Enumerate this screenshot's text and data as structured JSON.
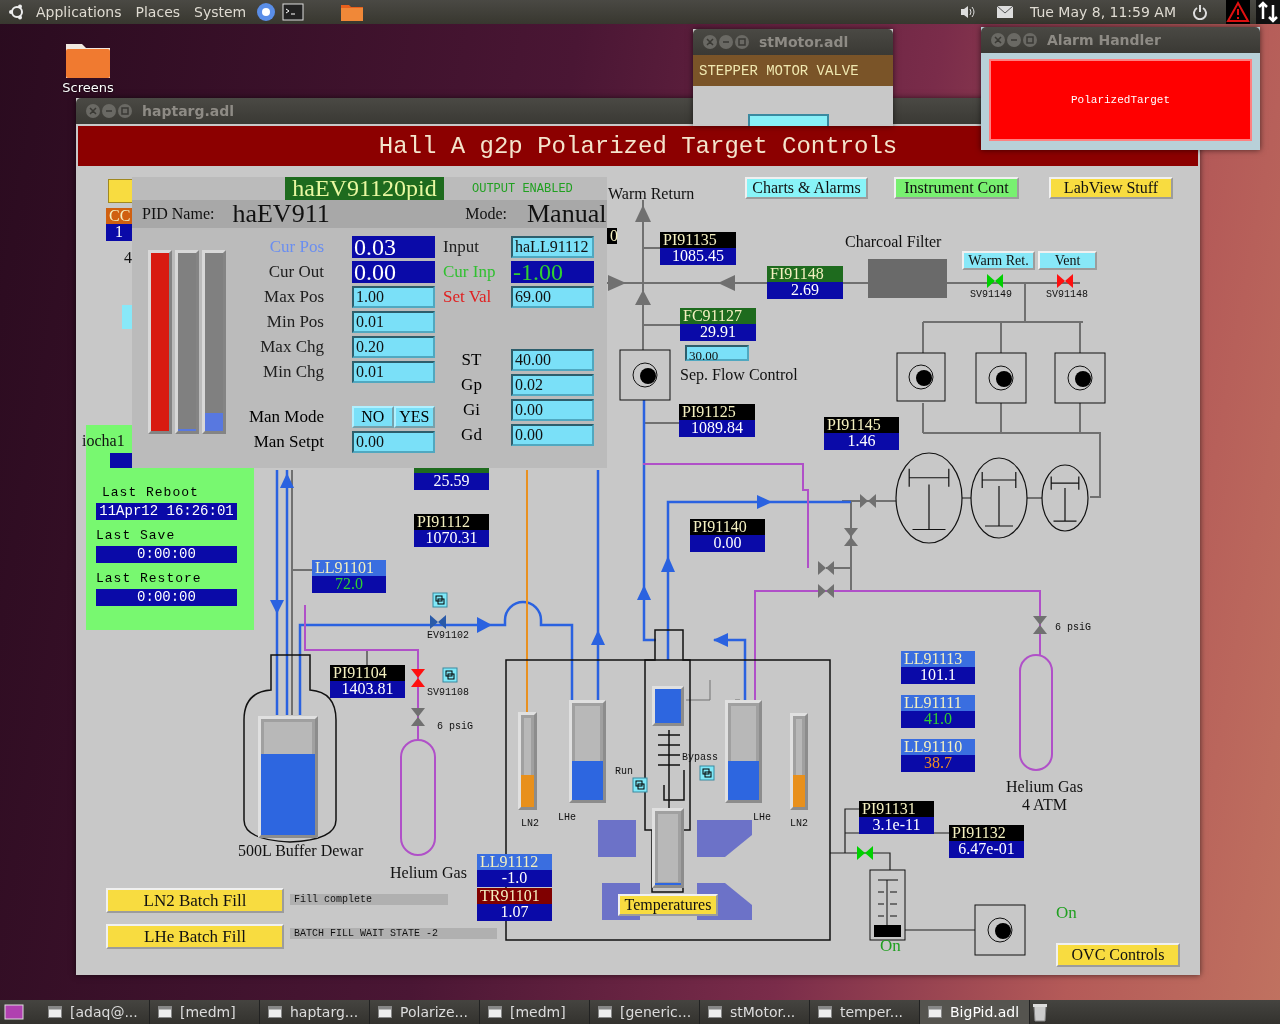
{
  "top_panel": {
    "menus": [
      "Applications",
      "Places",
      "System"
    ],
    "clock": "Tue May  8, 11:59 AM"
  },
  "desktop_icons": [
    {
      "label": "Screens"
    }
  ],
  "stmotor_window": {
    "title": "stMotor.adl",
    "heading": "STEPPER MOTOR VALVE"
  },
  "alarm_window": {
    "title": "Alarm Handler",
    "alarm": "PolarizedTarget"
  },
  "main_window": {
    "title": "haptarg.adl",
    "heading": "Hall A g2p Polarized Target Controls",
    "buttons": [
      {
        "label": "Charts & Alarms",
        "color": "#88f4f8"
      },
      {
        "label": "Instrument Cont",
        "color": "#78f070"
      },
      {
        "label": "LabView Stuff",
        "color": "#f8dc40"
      },
      {
        "label": "Warm Ret.",
        "color": "#88e8f8"
      },
      {
        "label": "Vent",
        "color": "#88e8f8"
      },
      {
        "label": "LN2 Batch Fill",
        "color": "#f8dc40"
      },
      {
        "label": "LHe Batch Fill",
        "color": "#f8dc40"
      },
      {
        "label": "Temperatures",
        "color": "#f8dc40"
      },
      {
        "label": "OVC Controls",
        "color": "#f8dc40"
      }
    ],
    "readouts": [
      {
        "tag": "CC",
        "value": "1",
        "color": "#d06010"
      },
      {
        "tag": "0",
        "color": "#000000"
      },
      {
        "tag": "PI91135",
        "value": "1085.45",
        "color": "#000000"
      },
      {
        "tag": "FI91148",
        "value": "2.69",
        "color": "#1e6b1e"
      },
      {
        "tag": "FC91127",
        "value": "29.91",
        "color": "#1e6b1e"
      },
      {
        "tag": "PI91125",
        "value": "1089.84",
        "color": "#000000"
      },
      {
        "tag": "PI91145",
        "value": "1.46",
        "color": "#000000"
      },
      {
        "value": "25.59",
        "color": "#1e6b1e"
      },
      {
        "tag": "PI91112",
        "value": "1070.31",
        "color": "#000000"
      },
      {
        "tag": "PI91140",
        "value": "0.00",
        "color": "#000000"
      },
      {
        "tag": "LL91101",
        "value": "72.0",
        "kind": "ok",
        "color": "#3a6ee0"
      },
      {
        "tag": "PI91104",
        "value": "1403.81",
        "color": "#000000"
      },
      {
        "tag": "LL91113",
        "value": "101.1",
        "color": "#3a6ee0"
      },
      {
        "tag": "LL91111",
        "value": "41.0",
        "kind": "ok",
        "color": "#3a6ee0"
      },
      {
        "tag": "LL91110",
        "value": "38.7",
        "kind": "warning",
        "color": "#3a6ee0"
      },
      {
        "tag": "PI91131",
        "value": "3.1e-11",
        "color": "#000000"
      },
      {
        "tag": "PI91132",
        "value": "6.47e-01",
        "color": "#000000"
      },
      {
        "tag": "LL91112",
        "value": "-1.0",
        "color": "#3a6ee0"
      },
      {
        "tag": "TR91101",
        "value": "1.07",
        "color": "#800000"
      }
    ],
    "setpoint_field": "30.00",
    "valves": [
      {
        "label": "SV91149",
        "color": "#00d000"
      },
      {
        "label": "SV91148",
        "color": "#ff1010"
      },
      {
        "label": "EV91102",
        "color": "#2a5aa8"
      },
      {
        "label": "SV91108",
        "color": "#ff1010"
      },
      {
        "color": "#00d000"
      }
    ],
    "gauges": [
      {
        "level": 0.7,
        "color": "#2d66e0"
      },
      {
        "label": "LN2",
        "level": 0.35,
        "color": "#e8901c"
      },
      {
        "label": "LHe",
        "level": 0.4,
        "color": "#2d66e0"
      },
      {
        "level": 1,
        "color": "#2d66e0"
      },
      {
        "level": 0,
        "color": "#2d66e0"
      },
      {
        "label": "LHe",
        "level": 0.4,
        "color": "#2d66e0"
      },
      {
        "label": "LN2",
        "level": 0.35,
        "color": "#e8901c"
      }
    ],
    "captions": [
      {
        "text": "Warm Return",
        "kind": "caption"
      },
      {
        "text": "Charcoal Filter",
        "kind": "caption"
      },
      {
        "text": "Sep. Flow Control",
        "kind": "caption"
      },
      {
        "text": "6 psiG",
        "kind": "tag"
      },
      {
        "text": "500L Buffer Dewar",
        "kind": "caption"
      },
      {
        "text": "Helium Gas",
        "kind": "caption"
      },
      {
        "text": "Run",
        "kind": "tag"
      },
      {
        "text": "Bypass",
        "kind": "tag"
      },
      {
        "text": "6 psiG",
        "kind": "tag"
      },
      {
        "text": "Helium Gas",
        "kind": "caption"
      },
      {
        "text": "4 ATM",
        "kind": "caption"
      },
      {
        "text": "On",
        "kind": "status"
      },
      {
        "text": "On",
        "kind": "status"
      },
      {
        "text": "iocha1",
        "kind": "caption"
      },
      {
        "text": "4",
        "kind": "caption"
      }
    ],
    "ioc_panel": [
      {
        "label": "Last Reboot",
        "value": "11Apr12 16:26:01"
      },
      {
        "label": "Last Save",
        "value": "0:00:00"
      },
      {
        "label": "Last Restore",
        "value": "0:00:00"
      }
    ],
    "fill_status": [
      "Fill complete",
      "BATCH FILL WAIT STATE -2"
    ]
  },
  "pid_window": {
    "title": "haEV91120pid",
    "status": "OUTPUT ENABLED",
    "name_label": "PID Name:",
    "name": "haEV911",
    "mode_label": "Mode:",
    "mode": "Manual",
    "bars": [
      {
        "level": 1,
        "color": "#d81a10"
      },
      {
        "level": 0,
        "color": "#5878e0"
      },
      {
        "level": 0.1,
        "color": "#5878e0"
      }
    ],
    "left_fields": [
      {
        "label": "Cur Pos",
        "value": "0.03",
        "kind": "display",
        "color": "#6a8ef0"
      },
      {
        "label": "Cur Out",
        "value": "0.00",
        "kind": "display"
      },
      {
        "label": "Max Pos",
        "value": "1.00",
        "kind": "entry"
      },
      {
        "label": "Min Pos",
        "value": "0.01",
        "kind": "entry"
      },
      {
        "label": "Max Chg",
        "value": "0.20",
        "kind": "entry"
      },
      {
        "label": "Min Chg",
        "value": "0.01",
        "kind": "entry"
      }
    ],
    "manual": {
      "mode_label": "Man Mode",
      "options": [
        "NO",
        "YES"
      ],
      "setpoint_label": "Man Setpt",
      "setpoint": "0.00"
    },
    "right_fields": [
      {
        "label": "Input",
        "value": "haLL91112",
        "kind": "entry"
      },
      {
        "label": "Cur Inp",
        "value": "-1.00",
        "kind": "monitor",
        "color": "#30c030"
      },
      {
        "label": "Set Val",
        "value": "69.00",
        "kind": "entry",
        "color": "#e02020"
      }
    ],
    "gain_fields": [
      {
        "label": "ST",
        "value": "40.00"
      },
      {
        "label": "Gp",
        "value": "0.02"
      },
      {
        "label": "Gi",
        "value": "0.00"
      },
      {
        "label": "Gd",
        "value": "0.00"
      }
    ]
  },
  "taskbar": [
    {
      "label": "[adaq@...",
      "selected": false
    },
    {
      "label": "[medm]",
      "selected": false
    },
    {
      "label": "haptarg...",
      "selected": false
    },
    {
      "label": "Polarize...",
      "selected": false
    },
    {
      "label": "[medm]",
      "selected": false
    },
    {
      "label": "[generic...",
      "selected": false
    },
    {
      "label": "stMotor...",
      "selected": false
    },
    {
      "label": "temper...",
      "selected": false
    },
    {
      "label": "BigPid.adl",
      "selected": true
    }
  ]
}
